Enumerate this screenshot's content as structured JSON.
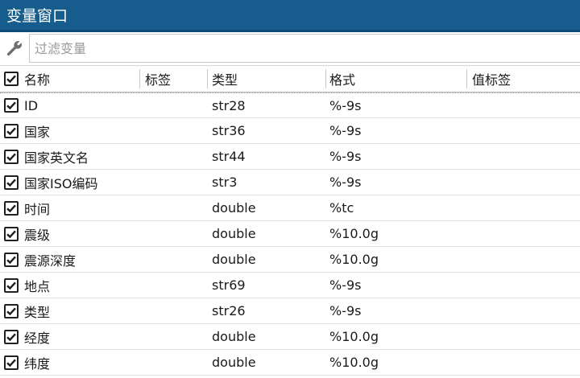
{
  "window": {
    "title": "变量窗口"
  },
  "filter": {
    "placeholder": "过滤变量",
    "value": ""
  },
  "icons": {
    "filter": "wrench-icon",
    "checkbox": "checkmark-icon"
  },
  "colors": {
    "title_bar": "#165c8d",
    "title_text": "#ffffff"
  },
  "columns": {
    "select_all_checked": true,
    "name": "名称",
    "label": "标签",
    "type": "类型",
    "format": "格式",
    "value_label": "值标签"
  },
  "variables": [
    {
      "checked": true,
      "name": "ID",
      "label": "",
      "type": "str28",
      "format": "%-9s",
      "value_label": ""
    },
    {
      "checked": true,
      "name": "国家",
      "label": "",
      "type": "str36",
      "format": "%-9s",
      "value_label": ""
    },
    {
      "checked": true,
      "name": "国家英文名",
      "label": "",
      "type": "str44",
      "format": "%-9s",
      "value_label": ""
    },
    {
      "checked": true,
      "name": "国家ISO编码",
      "label": "",
      "type": "str3",
      "format": "%-9s",
      "value_label": ""
    },
    {
      "checked": true,
      "name": "时间",
      "label": "",
      "type": "double",
      "format": "%tc",
      "value_label": ""
    },
    {
      "checked": true,
      "name": "震级",
      "label": "",
      "type": "double",
      "format": "%10.0g",
      "value_label": ""
    },
    {
      "checked": true,
      "name": "震源深度",
      "label": "",
      "type": "double",
      "format": "%10.0g",
      "value_label": ""
    },
    {
      "checked": true,
      "name": "地点",
      "label": "",
      "type": "str69",
      "format": "%-9s",
      "value_label": ""
    },
    {
      "checked": true,
      "name": "类型",
      "label": "",
      "type": "str26",
      "format": "%-9s",
      "value_label": ""
    },
    {
      "checked": true,
      "name": "经度",
      "label": "",
      "type": "double",
      "format": "%10.0g",
      "value_label": ""
    },
    {
      "checked": true,
      "name": "纬度",
      "label": "",
      "type": "double",
      "format": "%10.0g",
      "value_label": ""
    }
  ]
}
